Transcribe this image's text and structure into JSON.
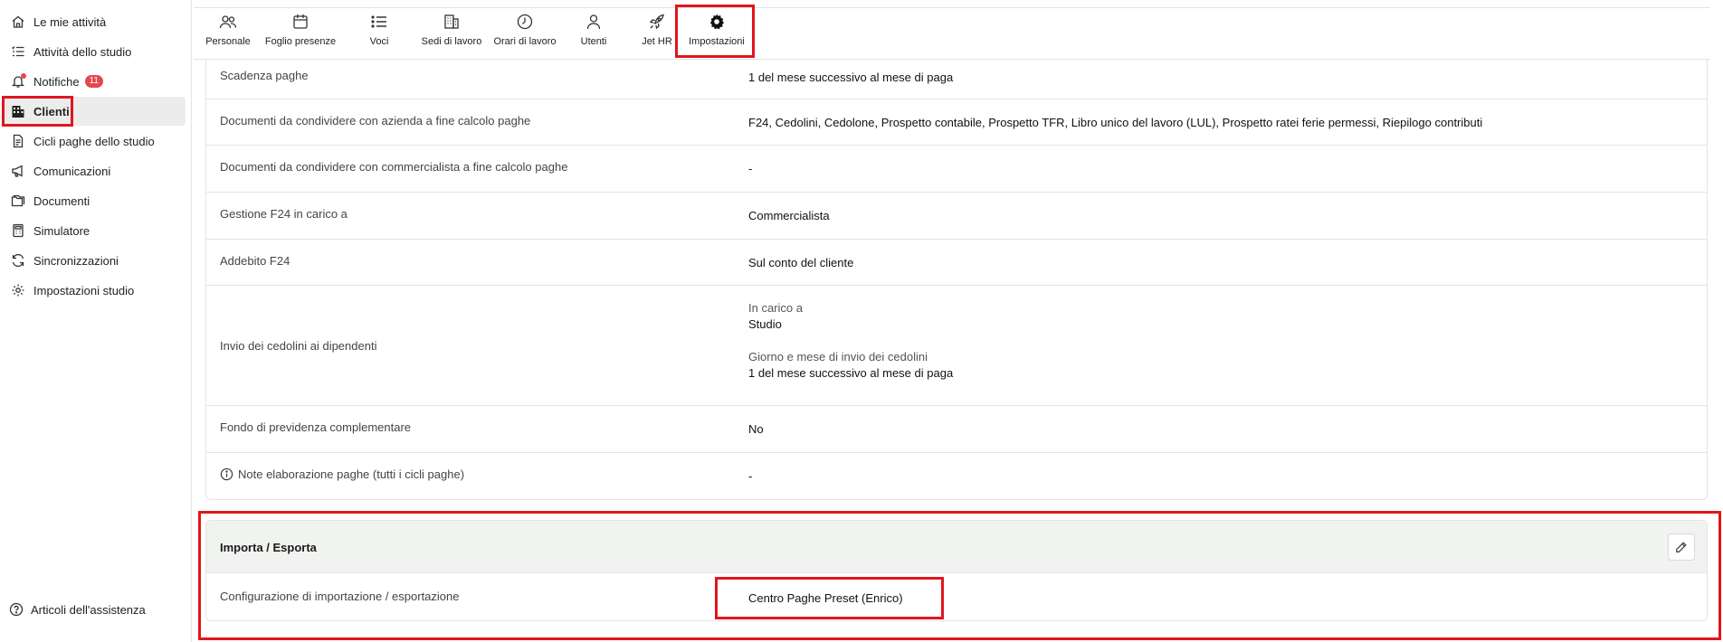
{
  "sidebar": {
    "items": [
      {
        "label": "Le mie attività",
        "icon": "home-icon"
      },
      {
        "label": "Attività dello studio",
        "icon": "checklist-icon"
      },
      {
        "label": "Notifiche",
        "icon": "bell-icon",
        "badge": "11"
      },
      {
        "label": "Clienti",
        "icon": "building-icon",
        "active": true
      },
      {
        "label": "Cicli paghe dello studio",
        "icon": "document-icon"
      },
      {
        "label": "Comunicazioni",
        "icon": "megaphone-icon"
      },
      {
        "label": "Documenti",
        "icon": "folder-icon"
      },
      {
        "label": "Simulatore",
        "icon": "calculator-icon"
      },
      {
        "label": "Sincronizzazioni",
        "icon": "sync-icon"
      },
      {
        "label": "Impostazioni studio",
        "icon": "gear-icon"
      }
    ],
    "help_label": "Articoli dell'assistenza"
  },
  "tabs": [
    {
      "label": "Personale",
      "icon": "people-icon"
    },
    {
      "label": "Foglio presenze",
      "icon": "calendar-icon"
    },
    {
      "label": "Voci",
      "icon": "list-icon"
    },
    {
      "label": "Sedi di lavoro",
      "icon": "building-icon"
    },
    {
      "label": "Orari di lavoro",
      "icon": "clock-icon"
    },
    {
      "label": "Utenti",
      "icon": "user-icon"
    },
    {
      "label": "Jet HR",
      "icon": "rocket-icon"
    },
    {
      "label": "Impostazioni",
      "icon": "gear-icon",
      "active": true
    }
  ],
  "settings": {
    "rows": [
      {
        "label": "Scadenza paghe",
        "value": "1 del mese successivo al mese di paga"
      },
      {
        "label": "Documenti da condividere con azienda a fine calcolo paghe",
        "value": "F24, Cedolini, Cedolone, Prospetto contabile, Prospetto TFR, Libro unico del lavoro (LUL), Prospetto ratei ferie permessi, Riepilogo contributi"
      },
      {
        "label": "Documenti da condividere con commercialista a fine calcolo paghe",
        "value": "-"
      },
      {
        "label": "Gestione F24 in carico a",
        "value": "Commercialista"
      },
      {
        "label": "Addebito F24",
        "value": "Sul conto del cliente"
      },
      {
        "label": "Invio dei cedolini ai dipendenti",
        "sub1_label": "In carico a",
        "sub1_value": "Studio",
        "sub2_label": "Giorno e mese di invio dei cedolini",
        "sub2_value": "1 del mese successivo al mese di paga"
      },
      {
        "label": "Fondo di previdenza complementare",
        "value": "No"
      },
      {
        "label": "Note elaborazione paghe (tutti i cicli paghe)",
        "value": "-"
      }
    ]
  },
  "import_export": {
    "title": "Importa / Esporta",
    "row_label": "Configurazione di importazione / esportazione",
    "row_value": "Centro Paghe Preset (Enrico)"
  },
  "colors": {
    "highlight": "#e0161e",
    "badge": "#e5484d",
    "section_header_bg": "#f1f3f0",
    "active_nav_bg": "#ececec"
  }
}
